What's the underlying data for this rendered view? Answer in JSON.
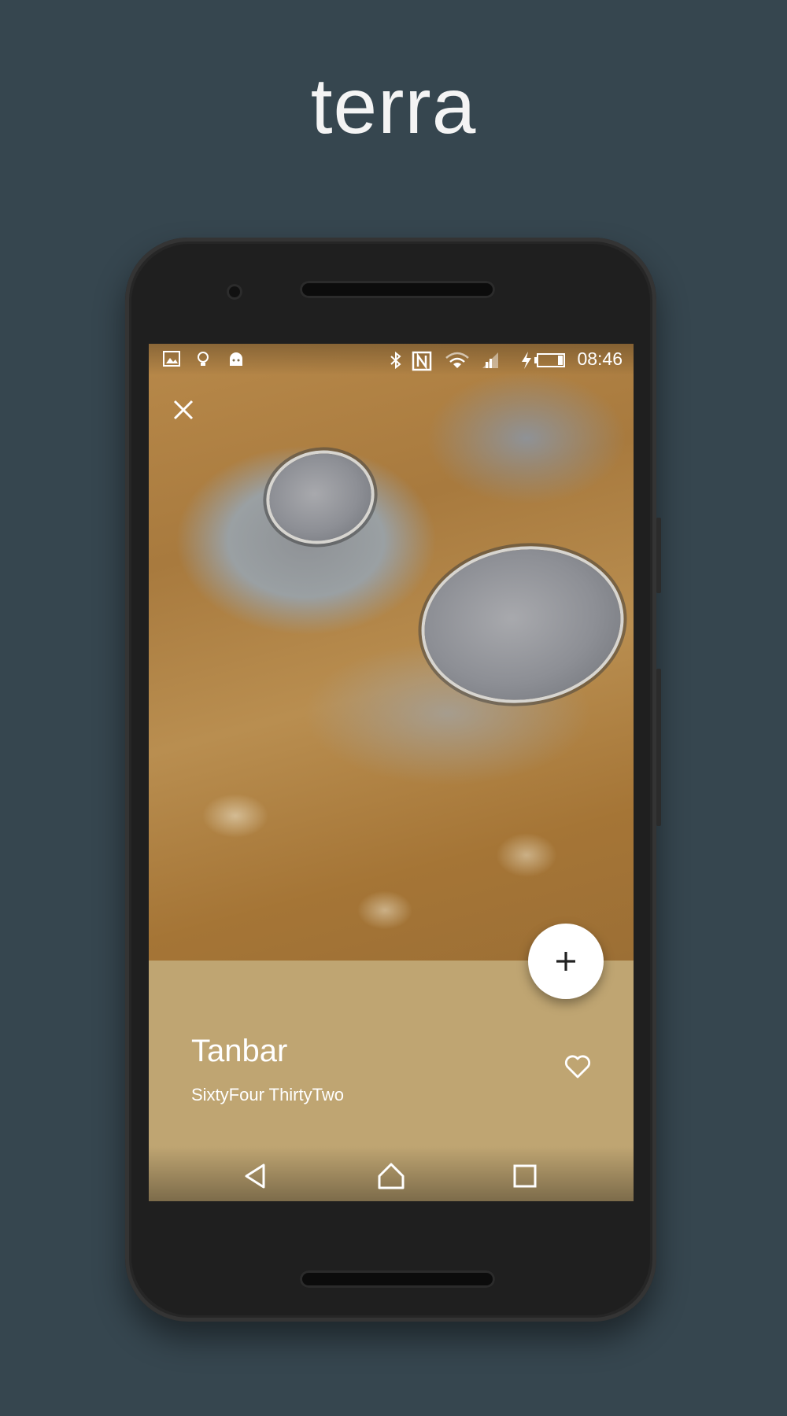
{
  "promo": {
    "app_name": "terra"
  },
  "statusbar": {
    "time": "08:46",
    "icons": [
      "image-icon",
      "lightbulb-icon",
      "android-icon",
      "bluetooth-icon",
      "nfc-icon",
      "wifi-icon",
      "signal-icon",
      "charging-icon",
      "battery-icon"
    ]
  },
  "wallpaper": {
    "title": "Tanbar",
    "author": "SixtyFour ThirtyTwo"
  },
  "actions": {
    "close_icon": "close-icon",
    "add_icon": "plus-icon",
    "favorite_icon": "heart-outline-icon"
  },
  "navbar": {
    "icons": [
      "back-icon",
      "home-icon",
      "recents-icon"
    ]
  },
  "colors": {
    "background": "#36464f",
    "info_panel": "#bfa572",
    "fab": "#ffffff",
    "phone_body": "#262626"
  }
}
